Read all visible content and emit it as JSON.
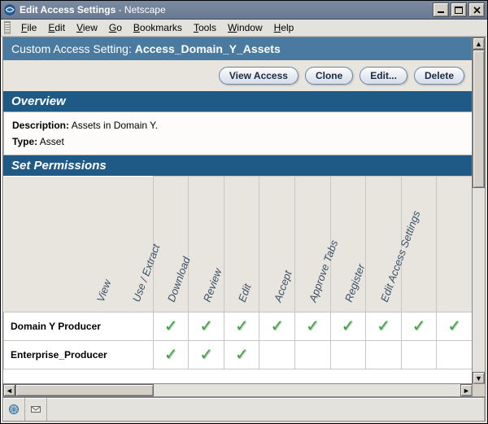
{
  "window": {
    "title_prefix": "Edit Access Settings",
    "title_app": " - Netscape"
  },
  "menubar": [
    "File",
    "Edit",
    "View",
    "Go",
    "Bookmarks",
    "Tools",
    "Window",
    "Help"
  ],
  "header": {
    "label": "Custom Access Setting: ",
    "name": "Access_Domain_Y_Assets"
  },
  "buttons": {
    "view_access": "View Access",
    "clone": "Clone",
    "edit": "Edit...",
    "delete": "Delete"
  },
  "sections": {
    "overview": "Overview",
    "set_permissions": "Set Permissions"
  },
  "overview": {
    "desc_label": "Description:",
    "desc_value": " Assets in Domain Y.",
    "type_label": "Type:",
    "type_value": " Asset"
  },
  "perm_columns": [
    "View",
    "Use / Extract",
    "Download",
    "Review",
    "Edit",
    "Accept",
    "Approve Tabs",
    "Register",
    "Edit Access Settings"
  ],
  "perm_rows": [
    {
      "name": "Domain Y Producer",
      "values": [
        true,
        true,
        true,
        true,
        true,
        true,
        true,
        true,
        true
      ]
    },
    {
      "name": "Enterprise_Producer",
      "values": [
        true,
        true,
        true,
        false,
        false,
        false,
        false,
        false,
        false
      ]
    }
  ]
}
